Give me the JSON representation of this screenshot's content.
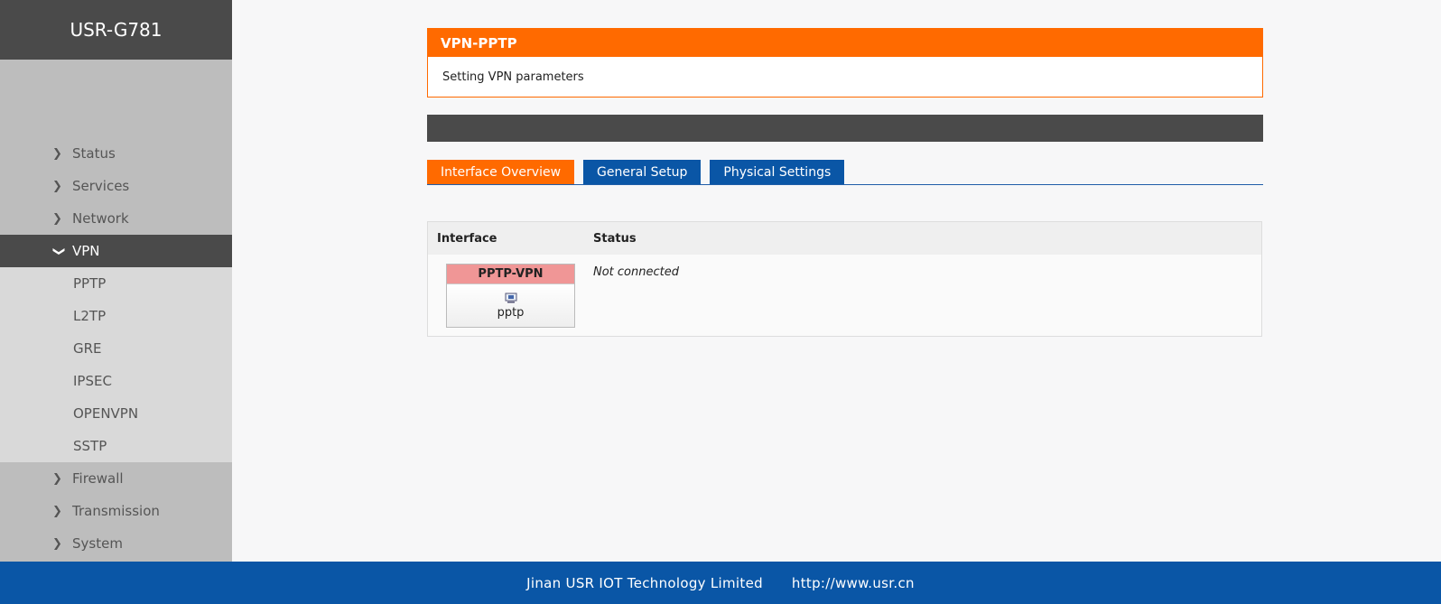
{
  "brand": "USR-G781",
  "menu": {
    "items": [
      {
        "label": "Status"
      },
      {
        "label": "Services"
      },
      {
        "label": "Network"
      },
      {
        "label": "VPN"
      },
      {
        "label": "Firewall"
      },
      {
        "label": "Transmission"
      },
      {
        "label": "System"
      }
    ],
    "vpn_sub": [
      "PPTP",
      "L2TP",
      "GRE",
      "IPSEC",
      "OPENVPN",
      "SSTP"
    ]
  },
  "panel": {
    "title": "VPN-PPTP",
    "description": "Setting VPN parameters"
  },
  "tabs": [
    "Interface Overview",
    "General Setup",
    "Physical Settings"
  ],
  "table": {
    "headers": {
      "interface": "Interface",
      "status": "Status"
    },
    "row": {
      "iface_name": "PPTP-VPN",
      "iface_proto": "pptp",
      "status": "Not connected"
    }
  },
  "footer": {
    "company": "Jinan USR IOT Technology Limited",
    "url": "http://www.usr.cn"
  },
  "colors": {
    "accent": "#ff6a00",
    "blue": "#0a56a6",
    "dark": "#4a4a4a"
  }
}
